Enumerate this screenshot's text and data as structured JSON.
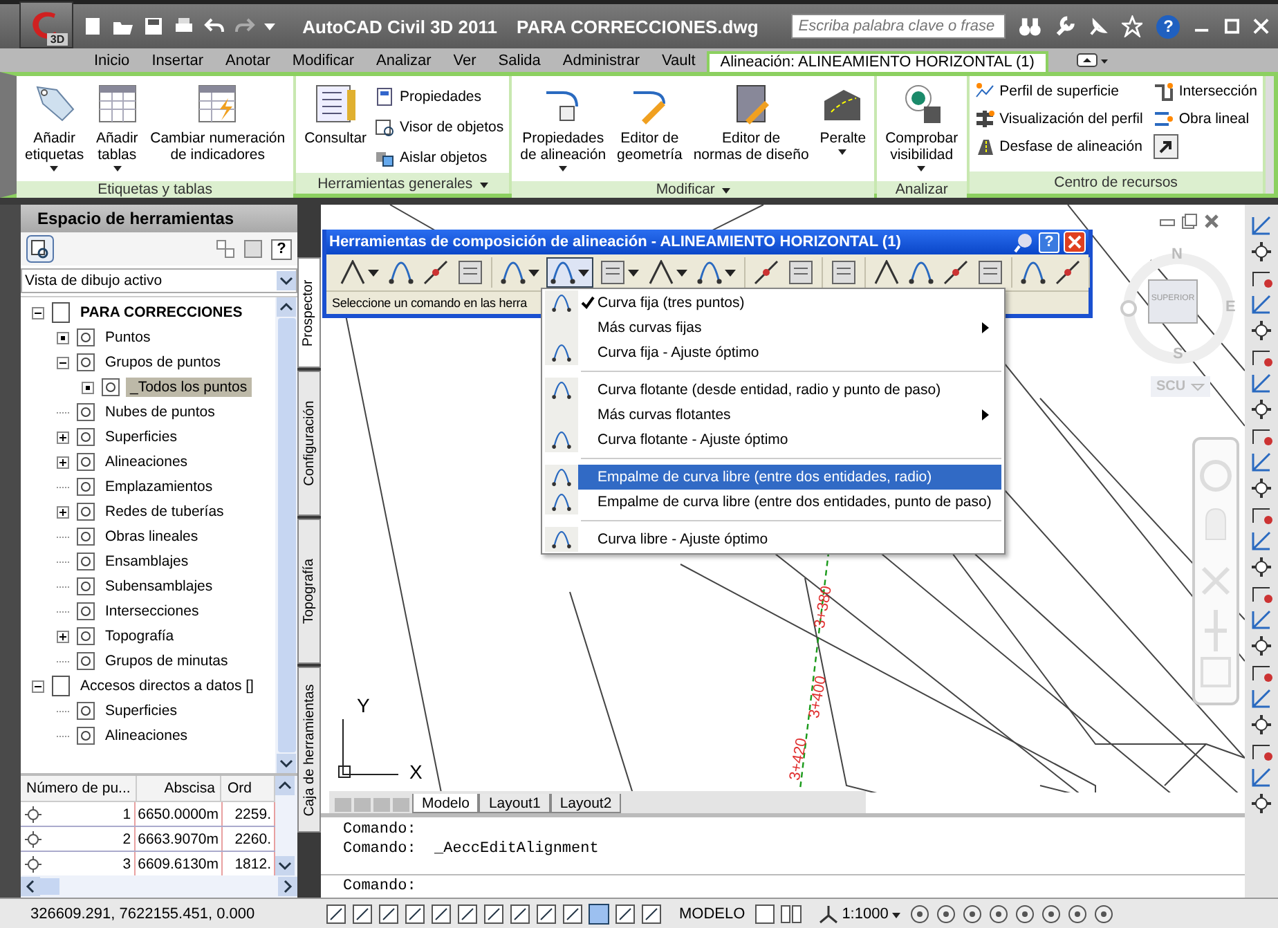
{
  "title_bar": {
    "app_badge": "3D",
    "title": "AutoCAD Civil 3D 2011",
    "document": "PARA CORRECCIONES.dwg",
    "search": {
      "placeholder": "Escriba palabra clave o frase"
    },
    "help_glyph": "?"
  },
  "ribbon_tabs": [
    {
      "label": "Inicio",
      "selected": false
    },
    {
      "label": "Insertar",
      "selected": false
    },
    {
      "label": "Anotar",
      "selected": false
    },
    {
      "label": "Modificar",
      "selected": false
    },
    {
      "label": "Analizar",
      "selected": false
    },
    {
      "label": "Ver",
      "selected": false
    },
    {
      "label": "Salida",
      "selected": false
    },
    {
      "label": "Administrar",
      "selected": false
    },
    {
      "label": "Vault",
      "selected": false
    },
    {
      "label": "Alineación: ALINEAMIENTO HORIZONTAL (1)",
      "selected": true
    }
  ],
  "ribbon_panels": [
    {
      "title": "Etiquetas y tablas",
      "expandable": false,
      "tools": [
        {
          "kind": "large",
          "label": "Añadir\netiquetas",
          "dropdown": true
        },
        {
          "kind": "large",
          "label": "Añadir\ntablas",
          "dropdown": true
        },
        {
          "kind": "large",
          "label": "Cambiar numeración\nde indicadores",
          "dropdown": false
        }
      ]
    },
    {
      "title": "Herramientas generales",
      "expandable": true,
      "tools": [
        {
          "kind": "large",
          "label": "Consultar",
          "dropdown": false
        },
        {
          "kind": "small",
          "label": "Propiedades"
        },
        {
          "kind": "small",
          "label": "Visor de objetos"
        },
        {
          "kind": "small",
          "label": "Aislar objetos"
        }
      ]
    },
    {
      "title": "Modificar",
      "expandable": true,
      "tools": [
        {
          "kind": "large",
          "label": "Propiedades\nde alineación",
          "dropdown": true
        },
        {
          "kind": "large",
          "label": "Editor de\ngeometría",
          "dropdown": false
        },
        {
          "kind": "large",
          "label": "Editor de\nnormas de diseño",
          "dropdown": false
        },
        {
          "kind": "large",
          "label": "Peralte",
          "dropdown": true
        }
      ]
    },
    {
      "title": "Analizar",
      "expandable": false,
      "tools": [
        {
          "kind": "large",
          "label": "Comprobar\nvisibilidad",
          "dropdown": true
        }
      ]
    },
    {
      "title": "Centro de recursos",
      "expandable": false,
      "tools": [
        {
          "kind": "small",
          "label": "Perfil de superficie"
        },
        {
          "kind": "small",
          "label": "Intersección"
        },
        {
          "kind": "small",
          "label": "Visualización del perfil"
        },
        {
          "kind": "small",
          "label": "Obra lineal"
        },
        {
          "kind": "small",
          "label": "Desfase de alineación"
        },
        {
          "kind": "launcher"
        }
      ]
    }
  ],
  "palette": {
    "title": "Espacio de herramientas",
    "view_selector": "Vista de dibujo activo",
    "help_glyph": "?",
    "tree": [
      {
        "label": "PARA CORRECCIONES",
        "bold": true,
        "toggle": true,
        "expanded": true,
        "selected": false,
        "children": [
          {
            "label": "Puntos",
            "toggle": true,
            "selected": false
          },
          {
            "label": "Grupos de puntos",
            "toggle": true,
            "expanded": true,
            "selected": false,
            "children": [
              {
                "label": "_Todos los puntos",
                "toggle": true,
                "selected": true
              }
            ]
          },
          {
            "label": "Nubes de puntos",
            "toggle": false,
            "selected": false
          },
          {
            "label": "Superficies",
            "toggle": true,
            "expanded": false,
            "selected": false
          },
          {
            "label": "Alineaciones",
            "toggle": true,
            "expanded": false,
            "selected": false
          },
          {
            "label": "Emplazamientos",
            "toggle": false,
            "selected": false
          },
          {
            "label": "Redes de tuberías",
            "toggle": true,
            "expanded": false,
            "selected": false
          },
          {
            "label": "Obras lineales",
            "toggle": false,
            "selected": false
          },
          {
            "label": "Ensamblajes",
            "toggle": false,
            "selected": false
          },
          {
            "label": "Subensamblajes",
            "toggle": false,
            "selected": false
          },
          {
            "label": "Intersecciones",
            "toggle": false,
            "selected": false
          },
          {
            "label": "Topografía",
            "toggle": true,
            "expanded": false,
            "selected": false
          },
          {
            "label": "Grupos de minutas",
            "toggle": false,
            "selected": false
          }
        ]
      },
      {
        "label": "Accesos directos a datos []",
        "bold": false,
        "toggle": true,
        "expanded": true,
        "selected": false,
        "children": [
          {
            "label": "Superficies",
            "toggle": false,
            "selected": false
          },
          {
            "label": "Alineaciones",
            "toggle": false,
            "selected": false
          }
        ]
      }
    ],
    "table": {
      "columns": [
        "Número de pu...",
        "Abscisa",
        "Ord"
      ],
      "rows": [
        [
          "1",
          "6650.0000m",
          "2259."
        ],
        [
          "2",
          "6663.9070m",
          "2260."
        ],
        [
          "3",
          "6609.6130m",
          "1812."
        ]
      ]
    },
    "side_tabs": [
      {
        "label": "Prospector",
        "selected": true
      },
      {
        "label": "Configuración",
        "selected": false
      },
      {
        "label": "Topografía",
        "selected": false
      },
      {
        "label": "Caja de herramientas",
        "selected": false
      }
    ]
  },
  "layout_toolbar": {
    "title": "Herramientas de composición de alineación - ALINEAMIENTO HORIZONTAL (1)",
    "prompt": "Seleccione un comando en las herra",
    "help_glyph": "?",
    "button_groups": [
      [
        {
          "dropdown": true,
          "pressed": false
        },
        {
          "dropdown": false,
          "pressed": false
        },
        {
          "dropdown": false,
          "pressed": false
        },
        {
          "dropdown": false,
          "pressed": false
        }
      ],
      [
        {
          "dropdown": true,
          "pressed": false
        },
        {
          "dropdown": true,
          "pressed": true
        },
        {
          "dropdown": true,
          "pressed": false
        },
        {
          "dropdown": true,
          "pressed": false
        },
        {
          "dropdown": true,
          "pressed": false
        }
      ],
      [
        {
          "dropdown": false,
          "pressed": false
        },
        {
          "dropdown": false,
          "pressed": false
        }
      ],
      [
        {
          "dropdown": false,
          "pressed": false
        }
      ],
      [
        {
          "dropdown": false,
          "pressed": false
        },
        {
          "dropdown": false,
          "pressed": false
        },
        {
          "dropdown": false,
          "pressed": false
        },
        {
          "dropdown": false,
          "pressed": false
        }
      ],
      [
        {
          "dropdown": false,
          "pressed": false
        },
        {
          "dropdown": false,
          "pressed": false
        }
      ]
    ]
  },
  "curve_menu": [
    [
      {
        "label": "Curva fija (tres puntos)",
        "checked": true,
        "submenu": false,
        "selected": false
      },
      {
        "label": "Más curvas fijas",
        "checked": false,
        "submenu": true,
        "selected": false
      },
      {
        "label": "Curva fija - Ajuste óptimo",
        "checked": false,
        "submenu": false,
        "selected": false
      }
    ],
    [
      {
        "label": "Curva flotante (desde entidad, radio y punto de paso)",
        "checked": false,
        "submenu": false,
        "selected": false
      },
      {
        "label": "Más curvas flotantes",
        "checked": false,
        "submenu": true,
        "selected": false
      },
      {
        "label": "Curva flotante - Ajuste óptimo",
        "checked": false,
        "submenu": false,
        "selected": false
      }
    ],
    [
      {
        "label": "Empalme de curva libre (entre dos entidades, radio)",
        "checked": false,
        "submenu": false,
        "selected": true
      },
      {
        "label": "Empalme de curva libre (entre dos entidades, punto de paso)",
        "checked": false,
        "submenu": false,
        "selected": false
      }
    ],
    [
      {
        "label": "Curva libre - Ajuste óptimo",
        "checked": false,
        "submenu": false,
        "selected": false
      }
    ]
  ],
  "drawing": {
    "stations": [
      "3+380",
      "3+400",
      "3+420"
    ],
    "ucs_axes": [
      "Y",
      "X"
    ],
    "viewcube": {
      "north": "N",
      "south": "S",
      "east": "E",
      "face": "SUPERIOR",
      "ucs_menu": "SCU"
    }
  },
  "layout_tabs": [
    {
      "label": "Modelo",
      "selected": true
    },
    {
      "label": "Layout1",
      "selected": false
    },
    {
      "label": "Layout2",
      "selected": false
    }
  ],
  "command_line": {
    "history": [
      "Comando:",
      "Comando:  _AeccEditAlignment"
    ],
    "prompt": "Comando:"
  },
  "status_bar": {
    "coordinates": "326609.291, 7622155.451, 0.000",
    "space": "MODELO",
    "annotation_scale": "1:1000"
  }
}
